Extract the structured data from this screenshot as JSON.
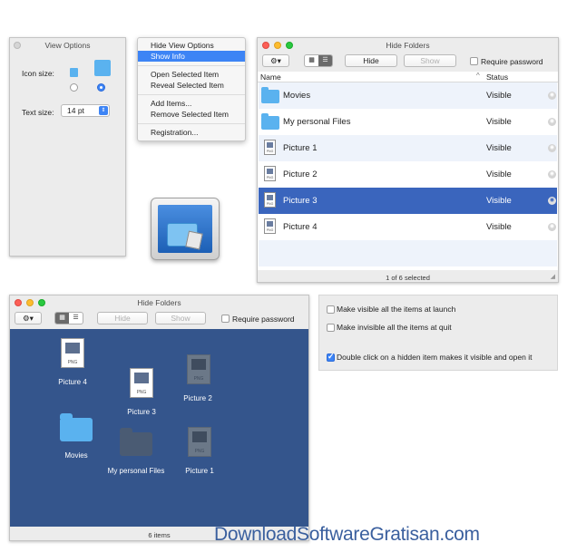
{
  "view_options": {
    "title": "View Options",
    "icon_size_label": "Icon size:",
    "text_size_label": "Text size:",
    "text_size_value": "14 pt"
  },
  "context_menu": {
    "items": [
      "Hide View Options",
      "Show Info",
      "Open Selected Item",
      "Reveal Selected Item",
      "Add Items...",
      "Remove Selected Item",
      "Registration..."
    ],
    "highlighted": "Show Info"
  },
  "list_window": {
    "title": "Hide Folders",
    "hide_label": "Hide",
    "show_label": "Show",
    "require_password": "Require password",
    "col_name": "Name",
    "col_status": "Status",
    "rows": [
      {
        "name": "Movies",
        "status": "Visible",
        "kind": "folder"
      },
      {
        "name": "My personal Files",
        "status": "Visible",
        "kind": "folder"
      },
      {
        "name": "Picture 1",
        "status": "Visible",
        "kind": "png"
      },
      {
        "name": "Picture 2",
        "status": "Visible",
        "kind": "png"
      },
      {
        "name": "Picture 3",
        "status": "Visible",
        "kind": "png",
        "selected": true
      },
      {
        "name": "Picture 4",
        "status": "Visible",
        "kind": "png"
      }
    ],
    "footer": "1 of 6 selected"
  },
  "icon_window": {
    "title": "Hide Folders",
    "hide_label": "Hide",
    "show_label": "Show",
    "require_password": "Require password",
    "items": {
      "picture4": "Picture 4",
      "picture3": "Picture 3",
      "picture2": "Picture 2",
      "movies": "Movies",
      "personal": "My personal Files",
      "picture1": "Picture 1"
    },
    "footer": "6 items"
  },
  "preferences": {
    "opt1": "Make visible all the items at launch",
    "opt2": "Make invisible all the items at quit",
    "opt3": "Double click on a hidden item makes it visible and open it",
    "opt3_checked": true
  },
  "watermark": "DownloadSoftwareGratisan.com",
  "colors": {
    "selection": "#3a65bd",
    "icon_view_bg": "#34558c",
    "folder": "#5ab2ef",
    "menu_highlight": "#3d84f5"
  }
}
